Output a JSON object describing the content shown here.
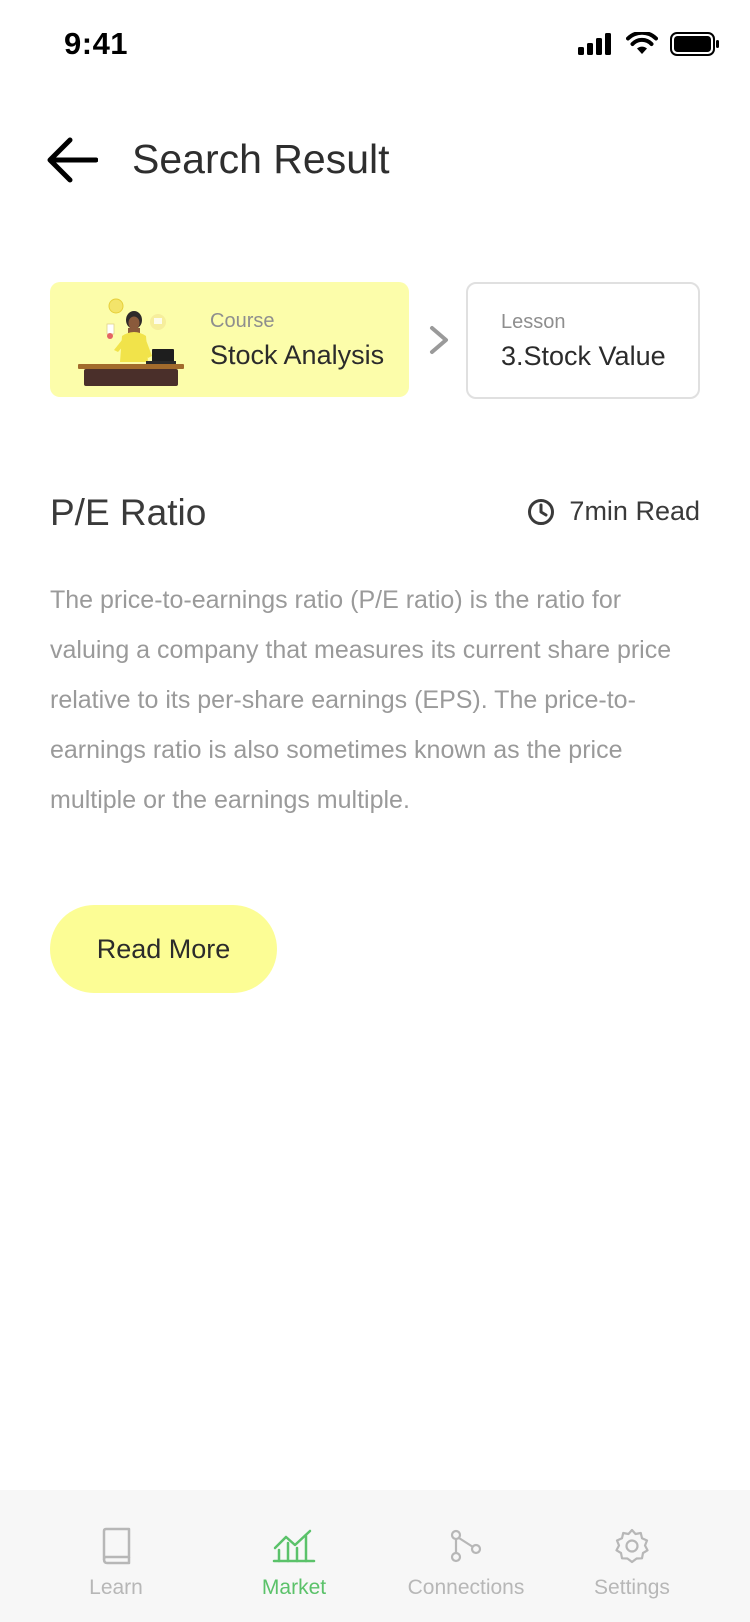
{
  "status_bar": {
    "time": "9:41"
  },
  "header": {
    "title": "Search Result"
  },
  "breadcrumb": {
    "course": {
      "label": "Course",
      "value": "Stock Analysis"
    },
    "lesson": {
      "label": "Lesson",
      "value": "3.Stock Value"
    }
  },
  "article": {
    "title": "P/E Ratio",
    "read_time": "7min Read",
    "body": "The price-to-earnings ratio (P/E ratio) is the ratio for valuing a company that measures its current share price relative to its per-share earnings (EPS). The price-to-earnings ratio is also sometimes known as the price multiple or the earnings multiple.",
    "read_more_label": "Read More"
  },
  "bottom_nav": {
    "items": [
      {
        "label": "Learn",
        "icon": "book-icon",
        "active": false
      },
      {
        "label": "Market",
        "icon": "chart-icon",
        "active": true
      },
      {
        "label": "Connections",
        "icon": "connections-icon",
        "active": false
      },
      {
        "label": "Settings",
        "icon": "gear-icon",
        "active": false
      }
    ]
  },
  "colors": {
    "accent_yellow": "#fcfdaa",
    "active_green": "#5bc26a",
    "inactive_gray": "#b7b7b7"
  }
}
